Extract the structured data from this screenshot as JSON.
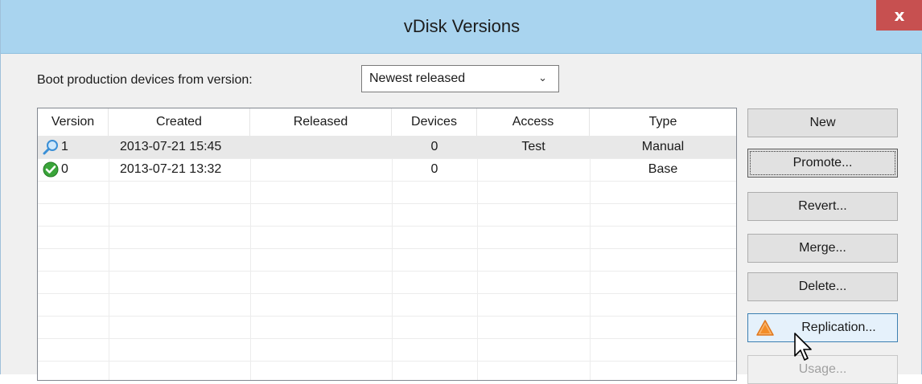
{
  "window": {
    "title": "vDisk Versions",
    "close_glyph": "x"
  },
  "boot": {
    "label": "Boot production devices from version:",
    "selected": "Newest released",
    "chevron": "⌄"
  },
  "table": {
    "columns": [
      "Version",
      "Created",
      "Released",
      "Devices",
      "Access",
      "Type"
    ],
    "rows": [
      {
        "icon": "magnifier-icon",
        "version": "1",
        "created": "2013-07-21 15:45",
        "released": "",
        "devices": "0",
        "access": "Test",
        "type": "Manual"
      },
      {
        "icon": "green-check-icon",
        "version": "0",
        "created": "2013-07-21 13:32",
        "released": "",
        "devices": "0",
        "access": "",
        "type": "Base"
      }
    ]
  },
  "buttons": {
    "new": "New",
    "promote": "Promote...",
    "revert": "Revert...",
    "merge": "Merge...",
    "delete": "Delete...",
    "replication": "Replication...",
    "usage": "Usage..."
  },
  "colors": {
    "titlebar": "#a9d4ef",
    "close": "#c75050",
    "warning": "#f28c28",
    "check": "#3aa53a",
    "magnifier": "#3a8fd6"
  }
}
